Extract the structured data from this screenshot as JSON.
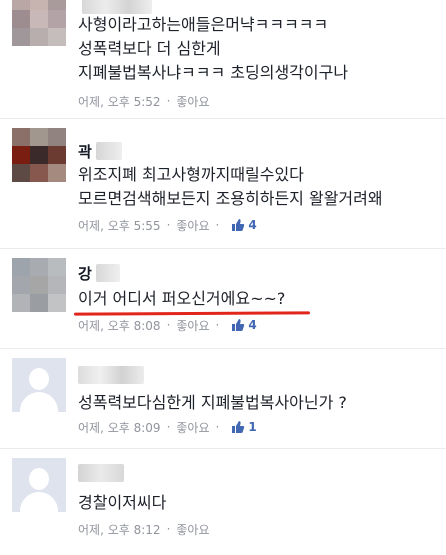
{
  "comments": [
    {
      "name": "",
      "lines": [
        "사형이라고하는애들은머냑ㅋㅋㅋㅋㅋ",
        "성폭력보다 더 심한게",
        "지폐불법복사냐ㅋㅋㅋ 초딩의생각이구나"
      ],
      "time": "어제, 오후 5:52",
      "like_label": "좋아요",
      "likes": ""
    },
    {
      "name": "곽",
      "lines": [
        "위조지폐 최고사형까지때릴수있다",
        "모르면검색해보든지 조용히하든지 왈왈거려왜"
      ],
      "time": "어제, 오후 5:55",
      "like_label": "좋아요",
      "likes": "4"
    },
    {
      "name": "강",
      "lines": [
        "이거 어디서 퍼오신거에요~~?"
      ],
      "time": "어제, 오후 8:08",
      "like_label": "좋아요",
      "likes": "4"
    },
    {
      "name": "",
      "lines": [
        "성폭력보다심한게 지폐불법복사아닌가 ?"
      ],
      "time": "어제, 오후 8:09",
      "like_label": "좋아요",
      "likes": "1"
    },
    {
      "name": "",
      "lines": [
        "경찰이저씨다"
      ],
      "time": "어제, 오후 8:12",
      "like_label": "좋아요",
      "likes": ""
    }
  ],
  "separator": "·",
  "colors": {
    "like_count": "#4267b2",
    "meta": "#90949c",
    "highlight_underline": "#e1251b"
  },
  "icons": {
    "like": "thumbs-up-icon",
    "avatar_default": "default-avatar-icon"
  }
}
